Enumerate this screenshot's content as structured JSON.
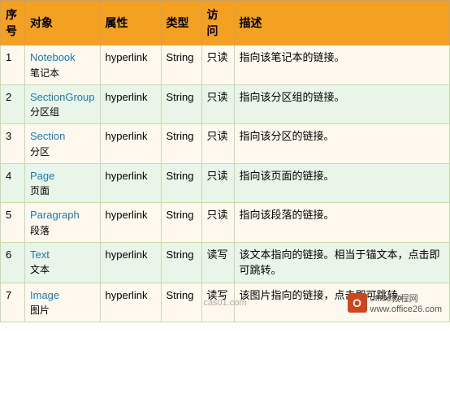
{
  "table": {
    "headers": [
      "序号",
      "对象",
      "属性",
      "类型",
      "访问",
      "描述"
    ],
    "rows": [
      {
        "seq": "1",
        "obj_en": "Notebook",
        "obj_cn": "笔记本",
        "attr": "hyperlink",
        "type": "String",
        "access": "只读",
        "desc": "指向该笔记本的链接。"
      },
      {
        "seq": "2",
        "obj_en": "SectionGroup",
        "obj_cn": "分区组",
        "attr": "hyperlink",
        "type": "String",
        "access": "只读",
        "desc": "指向该分区组的链接。"
      },
      {
        "seq": "3",
        "obj_en": "Section",
        "obj_cn": "分区",
        "attr": "hyperlink",
        "type": "String",
        "access": "只读",
        "desc": "指向该分区的链接。"
      },
      {
        "seq": "4",
        "obj_en": "Page",
        "obj_cn": "页面",
        "attr": "hyperlink",
        "type": "String",
        "access": "只读",
        "desc": "指向该页面的链接。"
      },
      {
        "seq": "5",
        "obj_en": "Paragraph",
        "obj_cn": "段落",
        "attr": "hyperlink",
        "type": "String",
        "access": "只读",
        "desc": "指向该段落的链接。"
      },
      {
        "seq": "6",
        "obj_en": "Text",
        "obj_cn": "文本",
        "attr": "hyperlink",
        "type": "String",
        "access": "读写",
        "desc": "该文本指向的链接。相当于锚文本，点击即可跳转。"
      },
      {
        "seq": "7",
        "obj_en": "Image",
        "obj_cn": "图片",
        "attr": "hyperlink",
        "type": "String",
        "access": "读写",
        "desc": "该图片指向的链接，点击即可跳转。"
      }
    ]
  },
  "watermark": "cas01.com",
  "logo": {
    "icon": "O",
    "text": "office教程网\nwww.office26.com"
  }
}
